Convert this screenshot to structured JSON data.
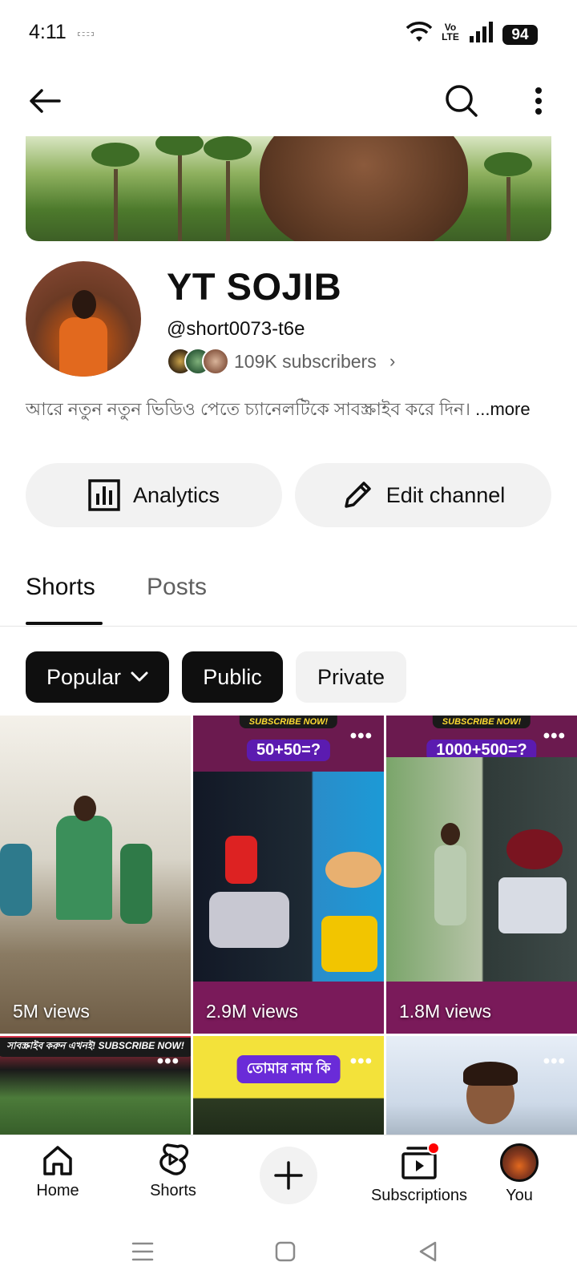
{
  "status_bar": {
    "time": "4:11",
    "volte": "Vo\nLTE",
    "battery": "94"
  },
  "channel": {
    "name": "YT SOJIB",
    "handle": "@short0073-t6e",
    "subscribers": "109K subscribers",
    "description": "আরে নতুন নতুন ভিডিও পেতে চ্যানেলটিকে সাবস্ক্রাইব করে দিন।",
    "more_label": "...more"
  },
  "actions": {
    "analytics_label": "Analytics",
    "edit_label": "Edit channel"
  },
  "tabs": [
    {
      "label": "Shorts",
      "selected": true
    },
    {
      "label": "Posts",
      "selected": false
    }
  ],
  "chips": {
    "popular": "Popular",
    "public": "Public",
    "private": "Private"
  },
  "shorts": [
    {
      "views": "5M views"
    },
    {
      "views": "2.9M views",
      "banner": "SUBSCRIBE NOW!",
      "puzzle": "50+50=?"
    },
    {
      "views": "1.8M views",
      "banner": "SUBSCRIBE NOW!",
      "puzzle": "1000+500=?"
    },
    {
      "banner": "সাবস্ক্রাইব করুন এখনই! SUBSCRIBE NOW!"
    },
    {
      "banner": "তোমার নাম কি"
    },
    {}
  ],
  "bottom_nav": {
    "home": "Home",
    "shorts": "Shorts",
    "subscriptions": "Subscriptions",
    "you": "You"
  },
  "colors": {
    "chip_active": "#0f0f0f",
    "chip_inactive": "#f2f2f2",
    "notification_dot": "#ff0000"
  }
}
